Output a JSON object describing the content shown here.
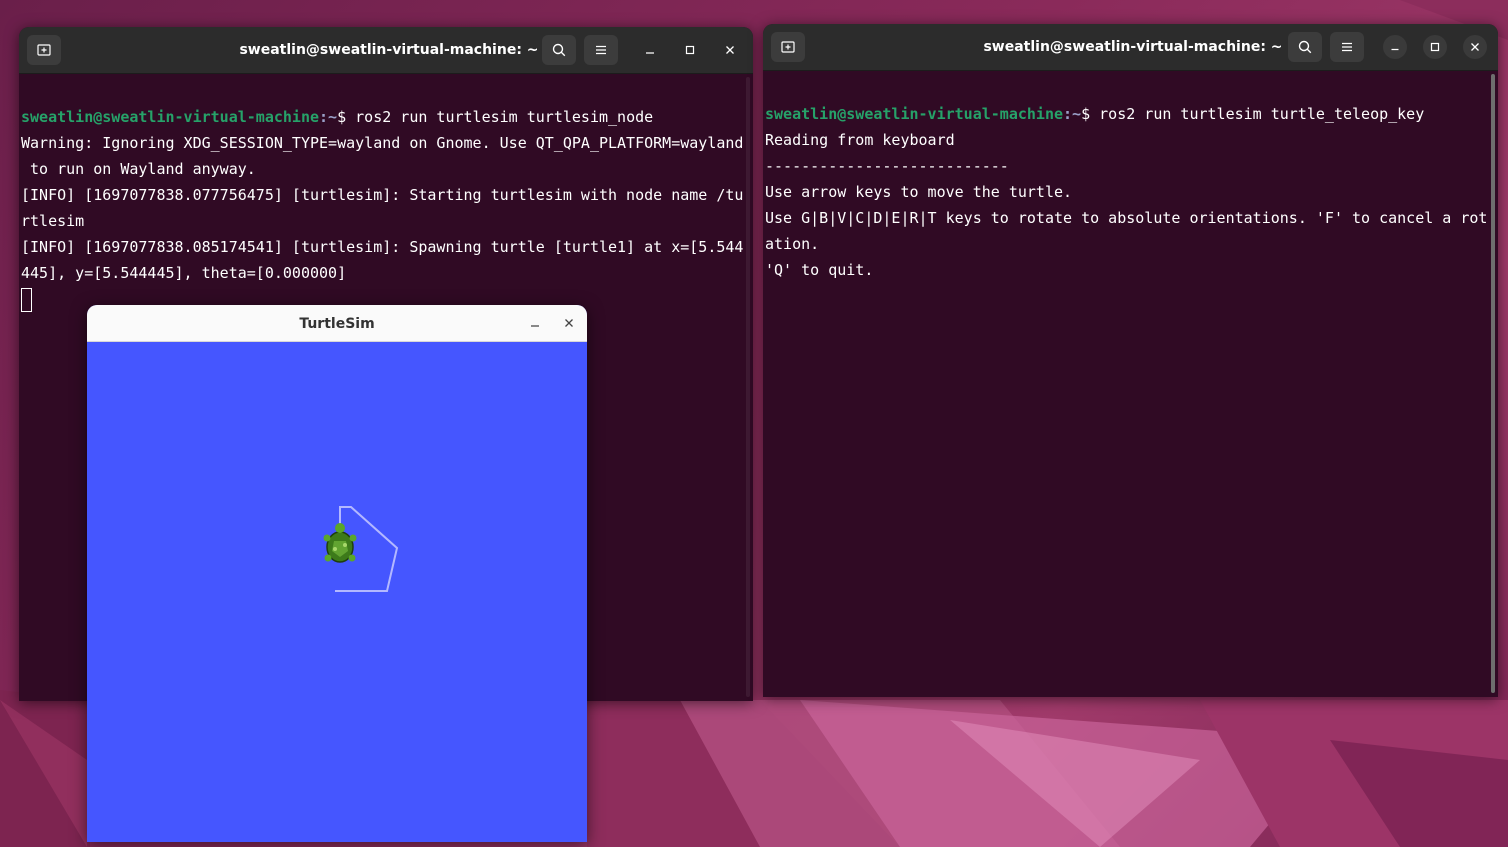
{
  "colors": {
    "terminal_bg": "#300a24",
    "prompt_user": "#26a269",
    "prompt_path": "#12488b",
    "turtlesim_bg": "#4556ff",
    "path_line": "#b3b8ff"
  },
  "left_terminal": {
    "title": "sweatlin@sweatlin-virtual-machine: ~",
    "new_tab_icon": "new-tab-icon",
    "prompt_user": "sweatlin@sweatlin-virtual-machine",
    "prompt_path": ":~",
    "prompt_symbol": "$ ",
    "command": "ros2 run turtlesim turtlesim_node",
    "lines": [
      "Warning: Ignoring XDG_SESSION_TYPE=wayland on Gnome. Use QT_QPA_PLATFORM=wayland",
      " to run on Wayland anyway.",
      "[INFO] [1697077838.077756475] [turtlesim]: Starting turtlesim with node name /tu",
      "rtlesim",
      "[INFO] [1697077838.085174541] [turtlesim]: Spawning turtle [turtle1] at x=[5.544",
      "445], y=[5.544445], theta=[0.000000]"
    ]
  },
  "right_terminal": {
    "title": "sweatlin@sweatlin-virtual-machine: ~",
    "prompt_user": "sweatlin@sweatlin-virtual-machine",
    "prompt_path": ":~",
    "prompt_symbol": "$ ",
    "command": "ros2 run turtlesim turtle_teleop_key",
    "lines": [
      "Reading from keyboard",
      "---------------------------",
      "Use arrow keys to move the turtle.",
      "Use G|B|V|C|D|E|R|T keys to rotate to absolute orientations. 'F' to cancel a rot",
      "ation.",
      "'Q' to quit."
    ]
  },
  "turtlesim": {
    "title": "TurtleSim",
    "minimize_icon": "minimize-icon",
    "close_icon": "close-icon",
    "turtle_name": "turtle1"
  }
}
